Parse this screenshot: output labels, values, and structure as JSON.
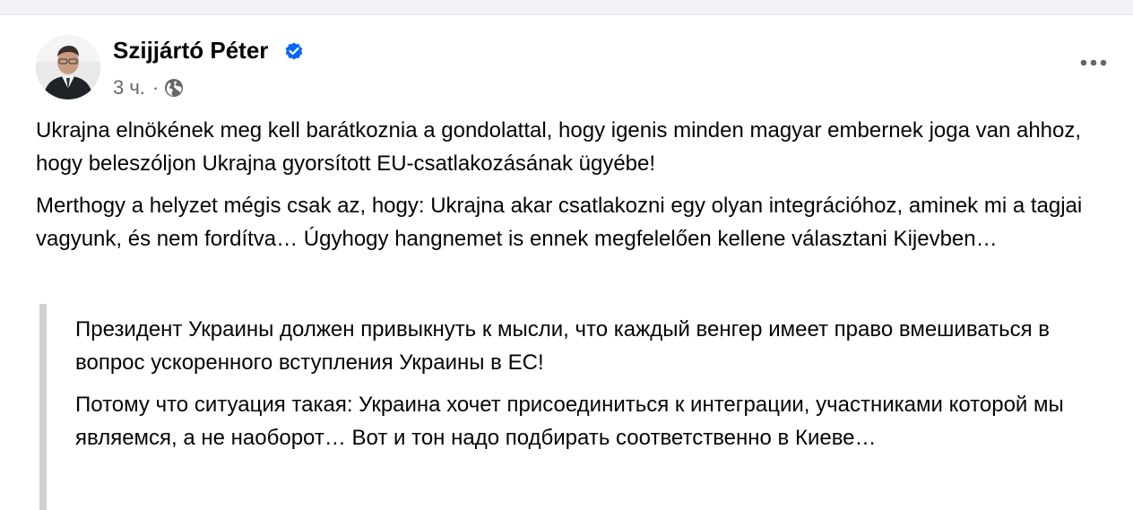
{
  "post": {
    "author": "Szijjártó Péter",
    "verified": true,
    "timestamp": "3 ч.",
    "separator": "·",
    "audience_icon": "globe-icon",
    "more_icon": "more-horizontal-icon",
    "paragraphs": [
      "Ukrajna elnökének meg kell barátkoznia a gondolattal, hogy igenis minden magyar embernek joga van ahhoz, hogy beleszóljon Ukrajna gyorsított EU-csatlakozásának ügyébe!",
      "Merthogy a helyzet mégis csak az, hogy: Ukrajna akar csatlakozni egy olyan integrációhoz, aminek mi a tagjai vagyunk, és nem fordítva… Úgyhogy hangnemet is ennek megfelelően kellene választani Kijevben…"
    ],
    "quote_paragraphs": [
      "Президент Украины должен привыкнуть к мысли, что каждый венгер имеет право вмешиваться в вопрос ускоренного вступления Украины в ЕС!",
      "Потому что ситуация такая: Украина хочет присоединиться к интеграции, участниками которой мы являемся, а не наоборот… Вот и тон надо подбирать соответственно в Киеве…"
    ]
  },
  "colors": {
    "verified_badge": "#0866ff",
    "secondary_text": "#65676b",
    "quote_border": "#ced0d4",
    "divider_background": "#f0f2f5"
  }
}
